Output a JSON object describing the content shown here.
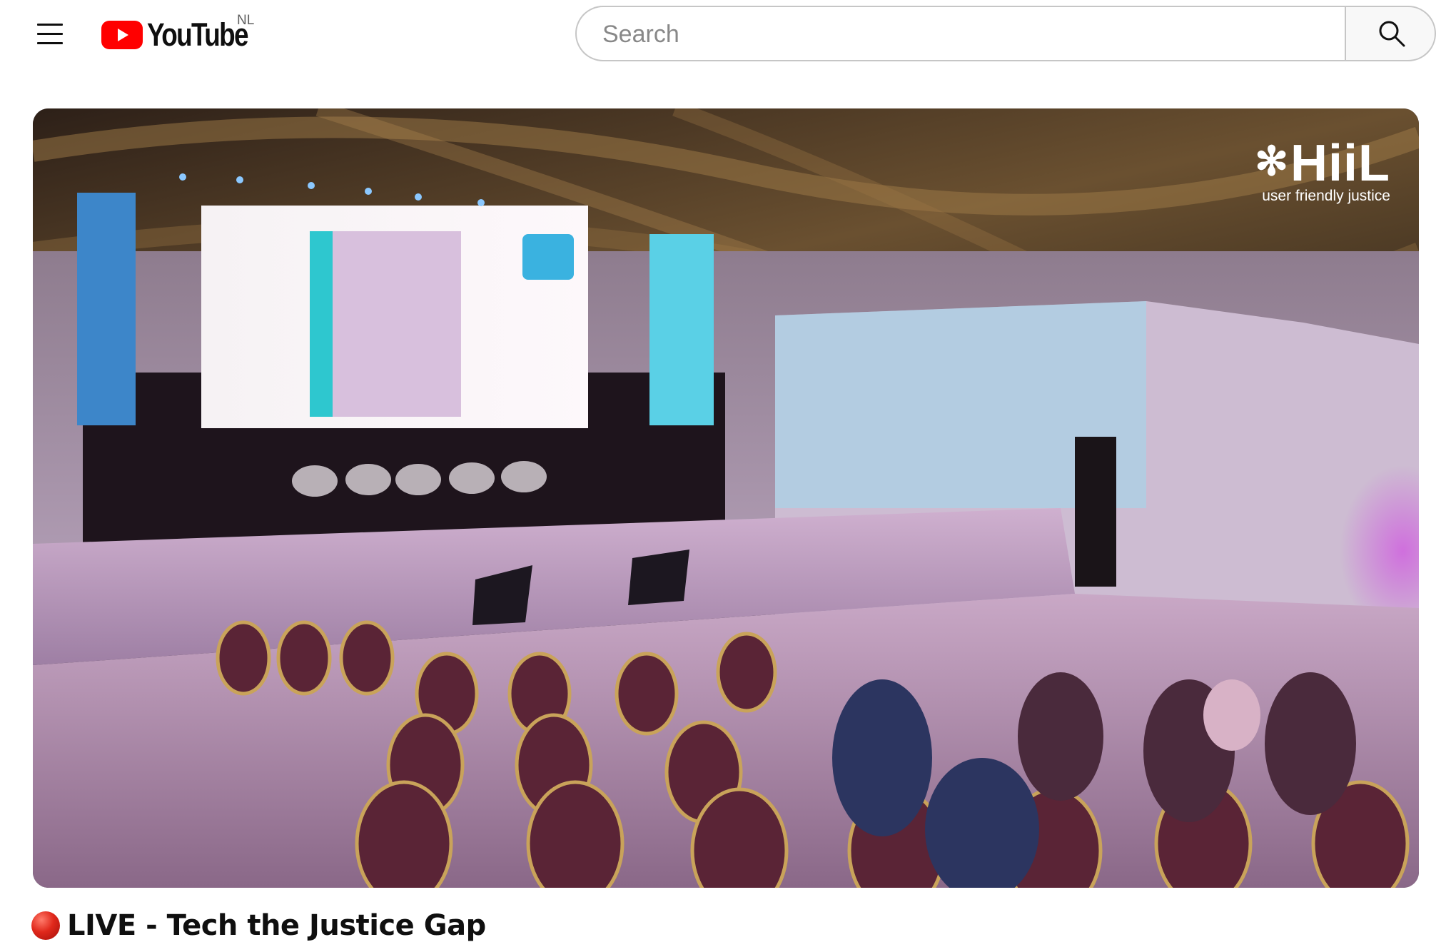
{
  "header": {
    "menu_icon": "hamburger-menu-icon",
    "logo_text": "YouTube",
    "country_code": "NL",
    "search": {
      "placeholder": "Search",
      "value": ""
    },
    "search_icon": "search-icon",
    "brand_color": "#ff0000"
  },
  "player": {
    "watermark": {
      "logo": "HiiL",
      "tagline": "user friendly justice"
    }
  },
  "video": {
    "live_icon": "red-circle-icon",
    "title": "LIVE - Tech the Justice Gap"
  }
}
